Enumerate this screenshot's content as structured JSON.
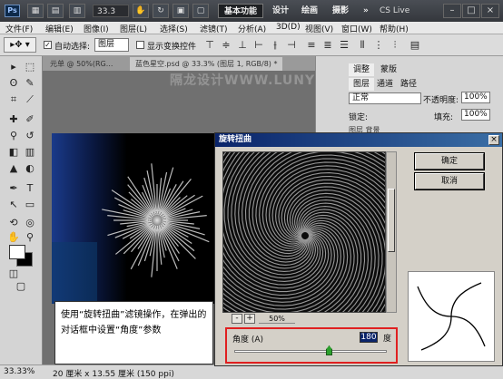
{
  "titlebar": {
    "app": "Ps",
    "zoom": "33.3",
    "workspaces": [
      "基本功能",
      "设计",
      "绘画",
      "摄影"
    ],
    "cs_live": "CS Live",
    "more": "»"
  },
  "menu": [
    "文件(F)",
    "编辑(E)",
    "图像(I)",
    "图层(L)",
    "选择(S)",
    "滤镜(T)",
    "分析(A)",
    "3D(D)",
    "视图(V)",
    "窗口(W)",
    "帮助(H)"
  ],
  "options": {
    "auto_select_label": "自动选择:",
    "auto_select_value": "图层",
    "show_transform_label": "显示变换控件"
  },
  "tabs": [
    {
      "label": "元单 @ 50%(RG..."
    },
    {
      "label": "蓝色星空.psd @ 33.3% (图层 1, RGB/8) *"
    }
  ],
  "watermark": "隔龙设计WWW.LUNYE.NET",
  "panels": {
    "top_tabs": [
      "调整",
      "蒙版"
    ],
    "layer_tabs": [
      "图层",
      "通道",
      "路径"
    ],
    "blend_mode": "正常",
    "opacity_label": "不透明度:",
    "opacity": "100%",
    "lock_label": "锁定:",
    "fill_label": "填充:",
    "fill": "100%",
    "layer_row": "图层 背景"
  },
  "status": {
    "zoom": "33.33%",
    "doc_info": "20 厘米 x 13.55 厘米 (150 ppi)"
  },
  "dialog": {
    "title": "旋转扭曲",
    "ok": "确定",
    "cancel": "取消",
    "zoom_minus": "-",
    "zoom_plus": "+",
    "zoom": "50%",
    "angle_label": "角度 (A)",
    "angle_value": "180",
    "angle_unit": "度",
    "angle_slider_fraction": 0.625
  },
  "callout": "使用“旋转扭曲”滤镜操作，在弹出的对话框中设置“角度”参数",
  "colors": {
    "dialog_title": "#0a246a",
    "highlight_box": "#e02020",
    "slider_thumb": "#2ca02c"
  }
}
